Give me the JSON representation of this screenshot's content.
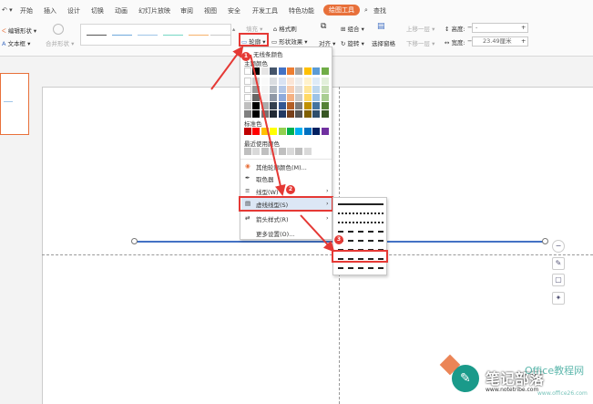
{
  "tabs": [
    "开始",
    "插入",
    "设计",
    "切换",
    "动画",
    "幻灯片放映",
    "审阅",
    "视图",
    "安全",
    "开发工具",
    "特色功能",
    "绘图工具",
    "查找"
  ],
  "ribbon": {
    "edit_shape": "编辑形状",
    "text_box": "文本框",
    "merge_shape": "合并形状",
    "fill": "填充",
    "format_brush": "格式刷",
    "outline": "轮廓",
    "shape_effect": "形状效果",
    "combine": "组合",
    "align": "对齐",
    "rotate": "旋转",
    "selection_pane": "选择窗格",
    "bring_forward": "上移一层",
    "send_backward": "下移一层",
    "height_label": "高度:",
    "width_label": "宽度:",
    "width_value": "23.49厘米",
    "height_value": "-"
  },
  "dropdown": {
    "no_line": "无线条颜色",
    "theme_colors": "主题颜色",
    "standard_colors": "标准色",
    "recent_colors": "最近使用颜色",
    "other_colors": "其他轮廓颜色(M)...",
    "eyedropper": "取色器",
    "line_type": "线型(W)",
    "dash_type": "虚线线型(S)",
    "arrow_style": "箭头样式(R)",
    "more_settings": "更多设置(O)..."
  },
  "badges": [
    "1",
    "2",
    "3"
  ],
  "watermark": {
    "brand": "笔记部落",
    "url": "www.notetribe.com",
    "office": "Office教程网",
    "office_sub": "www.office26.com"
  },
  "colors": {
    "accent": "#e8703a",
    "highlight": "#e53935",
    "line": "#4472c4"
  },
  "theme_palette": [
    "#ffffff",
    "#000000",
    "#e7e6e6",
    "#44546a",
    "#4472c4",
    "#ed7d31",
    "#a5a5a5",
    "#ffc000",
    "#5b9bd5",
    "#70ad47"
  ],
  "standard_palette": [
    "#c00000",
    "#ff0000",
    "#ffc000",
    "#ffff00",
    "#92d050",
    "#00b050",
    "#00b0f0",
    "#0070c0",
    "#002060",
    "#7030a0"
  ],
  "recent_palette": [
    "#bfbfbf",
    "#d9d9d9",
    "#bfbfbf",
    "#d9d9d9",
    "#bfbfbf",
    "#d9d9d9",
    "#bfbfbf",
    "#d9d9d9"
  ]
}
